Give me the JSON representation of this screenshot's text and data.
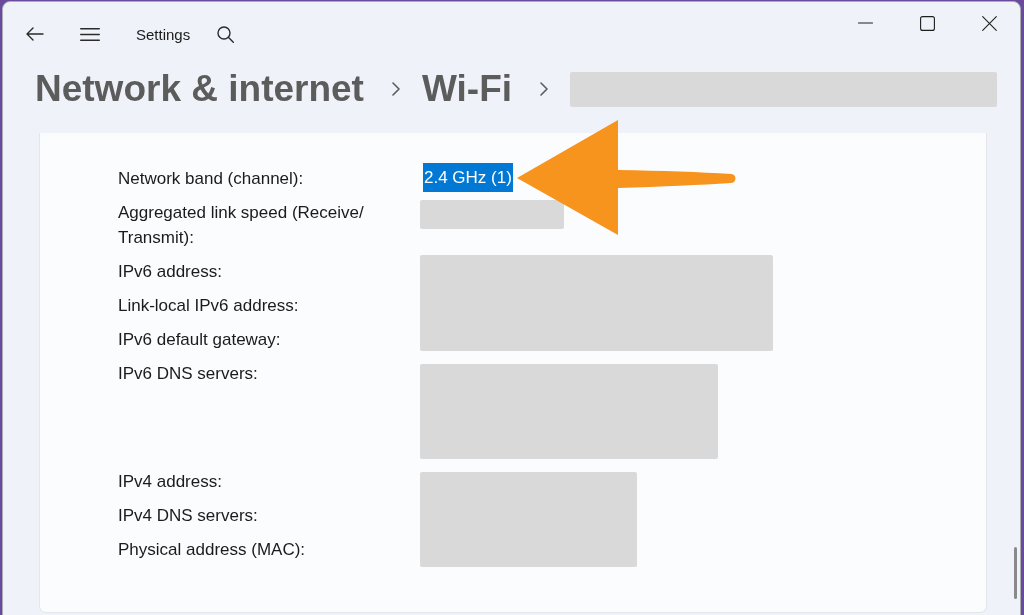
{
  "window": {
    "title": "Settings"
  },
  "breadcrumb": [
    {
      "kind": "text",
      "label": "Network & internet"
    },
    {
      "kind": "text",
      "label": "Wi-Fi"
    },
    {
      "kind": "redacted"
    }
  ],
  "details": [
    {
      "labels": [
        "Network band (channel):"
      ],
      "value": {
        "kind": "text",
        "text": "2.4 GHz (1)",
        "selected": true
      }
    },
    {
      "labels": [
        "Aggregated link speed (Receive/ Transmit):"
      ],
      "value": {
        "kind": "redacted"
      }
    },
    {
      "labels": [
        "IPv6 address:",
        "Link-local IPv6 address:",
        "IPv6 default gateway:"
      ],
      "value": {
        "kind": "redacted"
      }
    },
    {
      "labels": [
        "IPv6 DNS servers:"
      ],
      "value": {
        "kind": "redacted"
      }
    },
    {
      "labels": [
        "IPv4 address:",
        "IPv4 DNS servers:",
        "Physical address (MAC):"
      ],
      "value": {
        "kind": "redacted"
      }
    }
  ],
  "annotations": [
    {
      "kind": "arrow"
    }
  ]
}
